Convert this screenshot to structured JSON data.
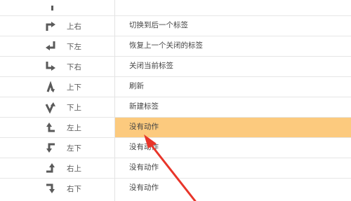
{
  "rows": [
    {
      "icon": "arrow-up-right-icon",
      "gesture": "上右",
      "action": "切换到后一个标签",
      "selected": false
    },
    {
      "icon": "arrow-down-left-icon",
      "gesture": "下左",
      "action": "恢复上一个关闭的标签",
      "selected": false
    },
    {
      "icon": "arrow-down-right-icon",
      "gesture": "下右",
      "action": "关闭当前标签",
      "selected": false
    },
    {
      "icon": "arrow-up-down-icon",
      "gesture": "上下",
      "action": "刷新",
      "selected": false
    },
    {
      "icon": "arrow-down-up-icon",
      "gesture": "下上",
      "action": "新建标签",
      "selected": false
    },
    {
      "icon": "arrow-left-up-icon",
      "gesture": "左上",
      "action": "没有动作",
      "selected": true
    },
    {
      "icon": "arrow-left-down-icon",
      "gesture": "左下",
      "action": "没有动作",
      "selected": false
    },
    {
      "icon": "arrow-right-up-icon",
      "gesture": "右上",
      "action": "没有动作",
      "selected": false
    },
    {
      "icon": "arrow-right-down-icon",
      "gesture": "右下",
      "action": "没有动作",
      "selected": false
    }
  ],
  "colors": {
    "selected_row": "#fcca7e",
    "annotation_arrow": "#e8352a",
    "icon": "#5a5a5a"
  }
}
